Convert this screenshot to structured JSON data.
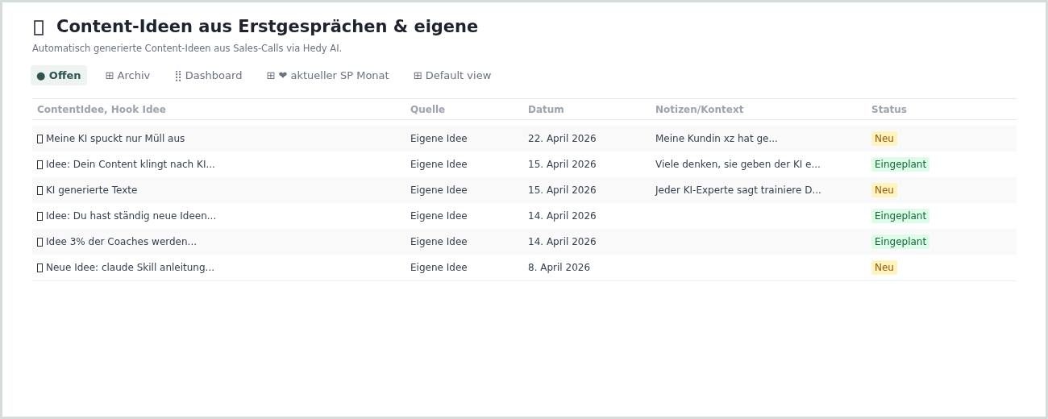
{
  "title": "Content-Ideen aus Erstgesprächen & eigene",
  "subtitle": "Automatisch generierte Content-Ideen aus Sales-Calls via Hedy AI.",
  "tabs": [
    {
      "label": "● Offen",
      "selected": true
    },
    {
      "label": "⊞ Archiv",
      "selected": false
    },
    {
      "label": "⣿ Dashboard",
      "selected": false
    },
    {
      "label": "⊞ ❤ aktueller SP Monat",
      "selected": false
    },
    {
      "label": "⊞ Default view",
      "selected": false
    }
  ],
  "table": {
    "columns": [
      "ContentIdee, Hook Idee",
      "Quelle",
      "Datum",
      "Notizen/Kontext",
      "Status"
    ],
    "rows": [
      {
        "idea": "Meine KI spuckt nur Müll aus",
        "source": "Eigene Idee",
        "date": "22. April 2026",
        "notes": "Meine Kundin xz hat ge...",
        "status": {
          "label": "Neu",
          "kind": "new"
        }
      },
      {
        "idea": "Idee: Dein Content klingt nach KI...",
        "source": "Eigene Idee",
        "date": "15. April 2026",
        "notes": "Viele denken, sie geben der KI e...",
        "status": {
          "label": "Eingeplant",
          "kind": "planned"
        }
      },
      {
        "idea": "KI generierte Texte",
        "source": "Eigene Idee",
        "date": "15. April 2026",
        "notes": "Jeder KI-Experte sagt trainiere D...",
        "status": {
          "label": "Neu",
          "kind": "new"
        }
      },
      {
        "idea": "Idee: Du hast ständig neue Ideen...",
        "source": "Eigene Idee",
        "date": "14. April 2026",
        "status": {
          "label": "Eingeplant",
          "kind": "planned"
        }
      },
      {
        "idea": "Idee 3% der Coaches werden...",
        "source": "Eigene Idee",
        "date": "14. April 2026",
        "status": {
          "label": "Eingeplant",
          "kind": "planned"
        }
      },
      {
        "idea": "Neue Idee: claude Skill anleitung...",
        "source": "Eigene Idee",
        "date": "8. April 2026",
        "status": {
          "label": "Neu",
          "kind": "new"
        }
      }
    ]
  }
}
